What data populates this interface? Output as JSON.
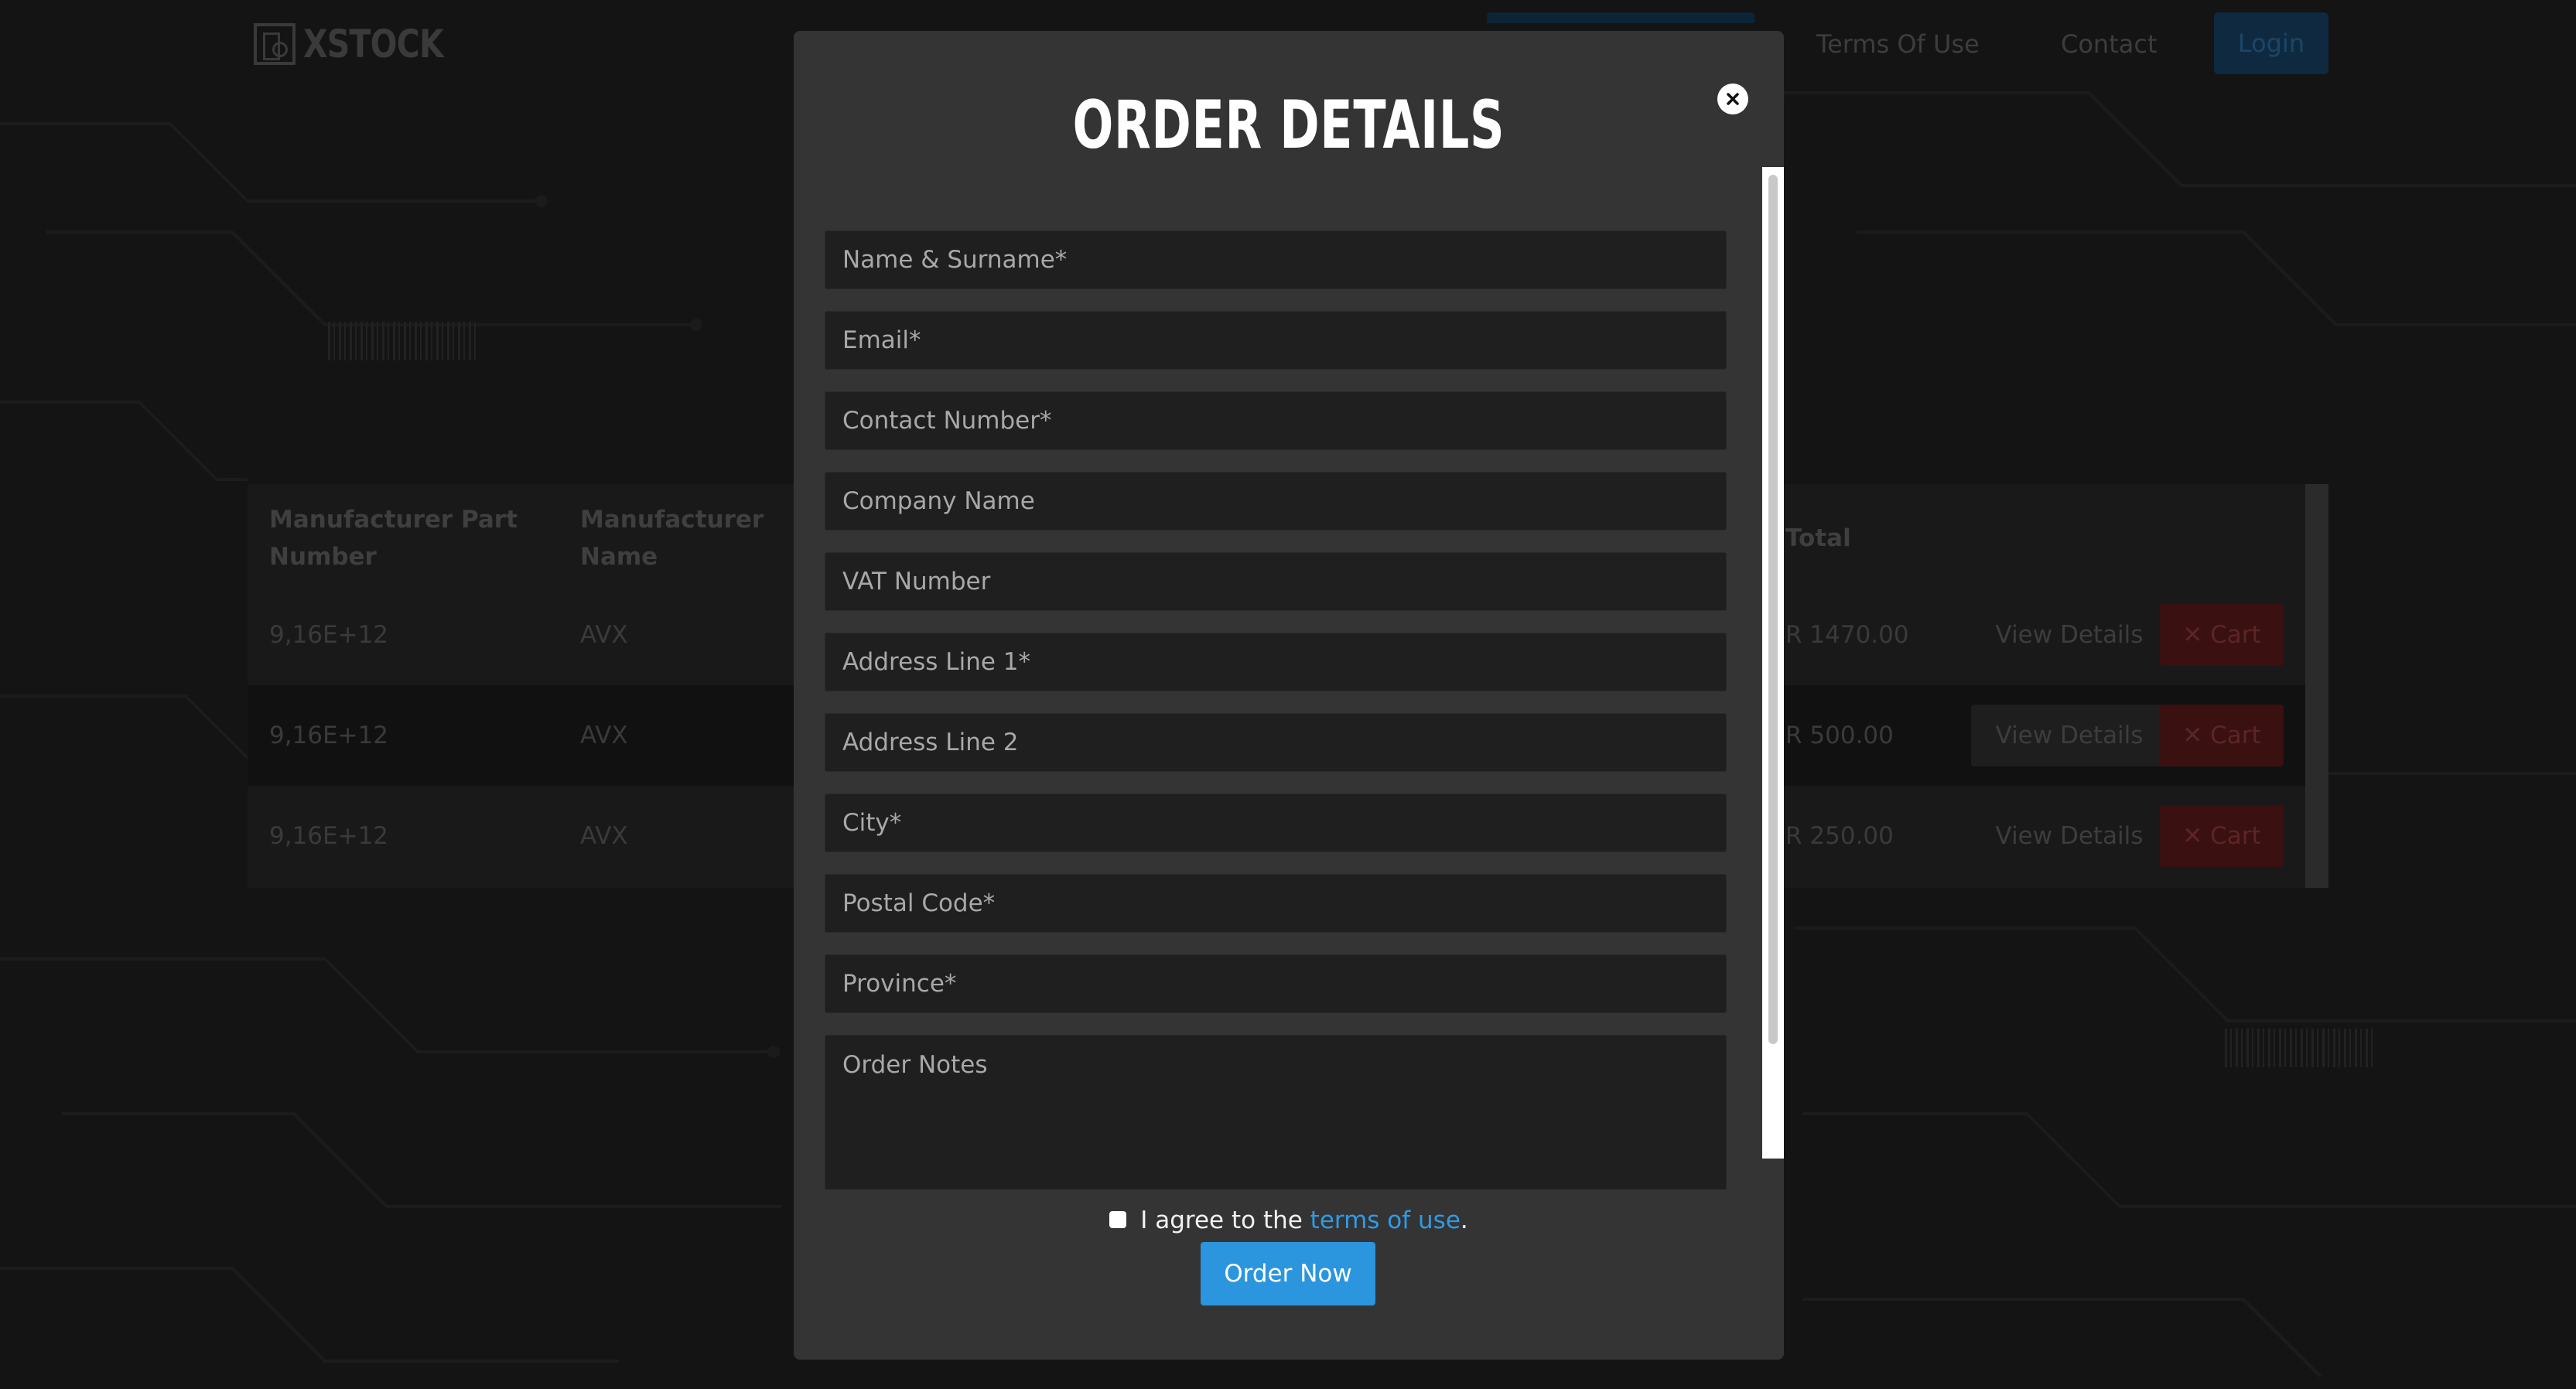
{
  "header": {
    "logo_text": "XSTOCK",
    "nav": {
      "terms": "Terms Of Use",
      "contact": "Contact"
    },
    "login_label": "Login"
  },
  "table": {
    "headers": {
      "mpn": "Manufacturer Part Number",
      "manufacturer": "Manufacturer Name",
      "total": "Total"
    },
    "rows": [
      {
        "mpn": "9,16E+12",
        "manufacturer": "AVX",
        "total": "R 1470.00",
        "view": "View Details",
        "cart": "✕ Cart"
      },
      {
        "mpn": "9,16E+12",
        "manufacturer": "AVX",
        "total": "R 500.00",
        "view": "View Details",
        "cart": "✕ Cart"
      },
      {
        "mpn": "9,16E+12",
        "manufacturer": "AVX",
        "total": "R 250.00",
        "view": "View Details",
        "cart": "✕ Cart"
      }
    ]
  },
  "modal": {
    "title": "ORDER DETAILS",
    "close_icon": "close-icon",
    "fields": {
      "name": {
        "placeholder": "Name & Surname*",
        "value": ""
      },
      "email": {
        "placeholder": "Email*",
        "value": ""
      },
      "contact": {
        "placeholder": "Contact Number*",
        "value": ""
      },
      "company": {
        "placeholder": "Company Name",
        "value": ""
      },
      "vat": {
        "placeholder": "VAT Number",
        "value": ""
      },
      "address1": {
        "placeholder": "Address Line 1*",
        "value": ""
      },
      "address2": {
        "placeholder": "Address Line 2",
        "value": ""
      },
      "city": {
        "placeholder": "City*",
        "value": ""
      },
      "postal": {
        "placeholder": "Postal Code*",
        "value": ""
      },
      "province": {
        "placeholder": "Province*",
        "value": ""
      },
      "notes": {
        "placeholder": "Order Notes",
        "value": ""
      }
    },
    "agree": {
      "prefix": "I agree to the ",
      "link": "terms of use",
      "suffix": "."
    },
    "order_button": "Order Now"
  },
  "colors": {
    "modal_bg": "#343434",
    "field_bg": "#1f1f1f",
    "accent": "#2b95de",
    "link": "#2e9be6",
    "page_bg": "#141414"
  }
}
